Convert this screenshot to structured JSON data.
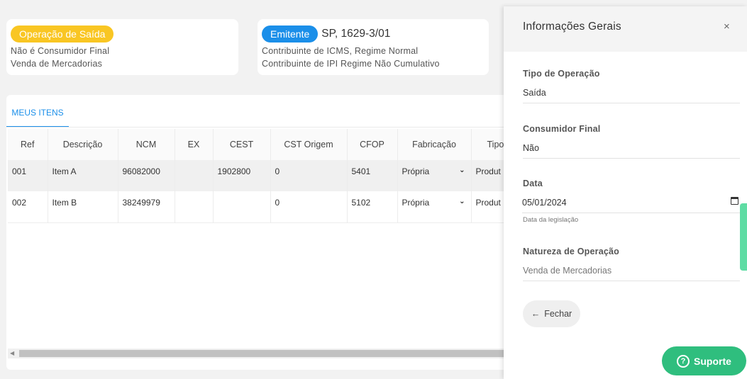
{
  "op_card": {
    "badge": "Operação de Saída",
    "line1": "Não é Consumidor Final",
    "line2": "Venda de Mercadorias"
  },
  "em_card": {
    "badge": "Emitente",
    "code": "SP, 1629-3/01",
    "line1": "Contribuinte de ICMS, Regime Normal",
    "line2": "Contribuinte de IPI Regime Não Cumulativo"
  },
  "items": {
    "tab_label": "MEUS ITENS",
    "columns": [
      "Ref",
      "Descrição",
      "NCM",
      "EX",
      "CEST",
      "CST Origem",
      "CFOP",
      "Fabricação",
      "Tipo"
    ],
    "rows": [
      {
        "ref": "001",
        "desc": "Item A",
        "ncm": "96082000",
        "ex": "",
        "cest": "1902800",
        "cst": "0",
        "cfop": "5401",
        "fab": "Própria",
        "tipo": "Produt"
      },
      {
        "ref": "002",
        "desc": "Item B",
        "ncm": "38249979",
        "ex": "",
        "cest": "",
        "cst": "0",
        "cfop": "5102",
        "fab": "Própria",
        "tipo": "Produt"
      }
    ]
  },
  "drawer": {
    "title": "Informações Gerais",
    "close": "×",
    "tipo_label": "Tipo de Operação",
    "tipo_value": "Saída",
    "consumidor_label": "Consumidor Final",
    "consumidor_value": "Não",
    "data_label": "Data",
    "data_value": "05/01/2024",
    "data_hint": "Data da legislação",
    "natureza_label": "Natureza de Operação",
    "natureza_value": "Venda de Mercadorias",
    "fechar_arrow": "←",
    "fechar_label": "Fechar"
  },
  "support": {
    "icon": "?",
    "label": "Suporte"
  },
  "colors": {
    "yellow_badge": "#f9c623",
    "blue_badge": "#1b8fe9",
    "support_green": "#2fbe7e"
  }
}
